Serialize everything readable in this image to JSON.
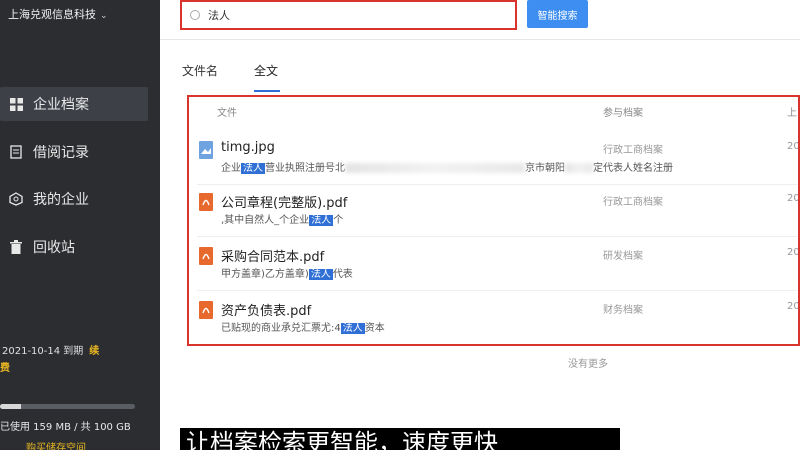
{
  "sidebar": {
    "company": "上海兑观信息科技",
    "items": [
      {
        "label": "企业档案",
        "icon": "grid-icon"
      },
      {
        "label": "借阅记录",
        "icon": "document-icon"
      },
      {
        "label": "我的企业",
        "icon": "building-icon"
      },
      {
        "label": "回收站",
        "icon": "trash-icon"
      }
    ],
    "expire_text": "2021-10-14 到期",
    "renew_label": "续",
    "renew_cont": "费",
    "storage_used_fraction": 0.159,
    "storage_text": "已使用 159 MB / 共 100 GB",
    "buy_label": "购买储存空间"
  },
  "search": {
    "value": "法人",
    "button_label": "智能搜索"
  },
  "tabs": [
    "文件名",
    "全文"
  ],
  "results": {
    "headers": {
      "file": "文件",
      "category": "参与档案",
      "col3": "上"
    },
    "rows": [
      {
        "name": "timg.jpg",
        "type": "img",
        "snippet_pre": "企业",
        "snippet_hl": "法人",
        "snippet_mid": "营业执照注册号北",
        "snippet_post": "京市朝阳",
        "snippet_tail": "定代表人姓名注册",
        "category": "行政工商档案",
        "year": "20"
      },
      {
        "name": "公司章程(完整版).pdf",
        "type": "pdf",
        "snippet_pre": ",其中自然人_个企业",
        "snippet_hl": "法人",
        "snippet_post": "个",
        "category": "行政工商档案",
        "year": "20"
      },
      {
        "name": "采购合同范本.pdf",
        "type": "pdf",
        "snippet_pre": "甲方盖章)乙方盖章)",
        "snippet_hl": "法人",
        "snippet_post": "代表",
        "category": "研发档案",
        "year": "20"
      },
      {
        "name": "资产负债表.pdf",
        "type": "pdf",
        "snippet_pre": "已贴现的商业承兑汇票尤:4",
        "snippet_hl": "法人",
        "snippet_post": "资本",
        "category": "财务档案",
        "year": "20"
      }
    ],
    "no_more": "没有更多"
  },
  "caption": "让档案检索更智能，速度更快"
}
